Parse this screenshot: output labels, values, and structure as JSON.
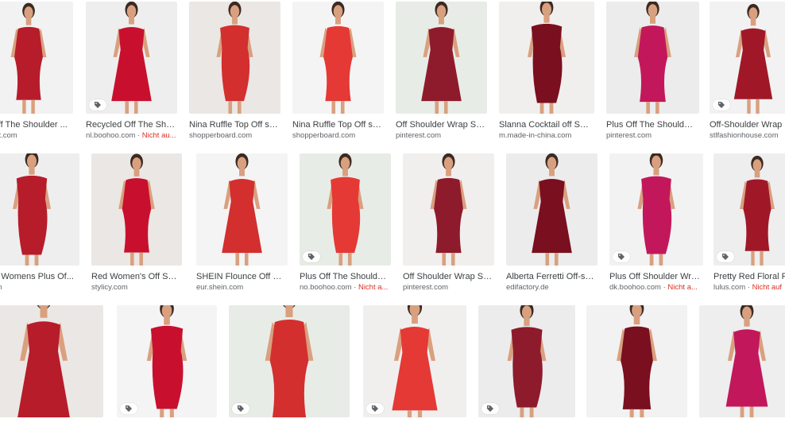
{
  "accent": "#d93025",
  "dress_colors": [
    "#b71c2b",
    "#c8102e",
    "#d32f2f",
    "#e53935",
    "#8e1b2c",
    "#7a0f1f",
    "#c2185b",
    "#a01828"
  ],
  "rows": [
    {
      "items": [
        {
          "title": "e Off The Shoulder ...",
          "source": "erest.com",
          "note": "",
          "tag": false
        },
        {
          "title": "Recycled Off The Shoul...",
          "source": "nl.boohoo.com",
          "note": "Nicht au...",
          "tag": true
        },
        {
          "title": "Nina Ruffle Top Off sho...",
          "source": "shopperboard.com",
          "note": "",
          "tag": false
        },
        {
          "title": "Nina Ruffle Top Off sho...",
          "source": "shopperboard.com",
          "note": "",
          "tag": false
        },
        {
          "title": "Off Shoulder Wrap Skir...",
          "source": "pinterest.com",
          "note": "",
          "tag": false
        },
        {
          "title": "Slanna Cocktail off Sho...",
          "source": "m.made-in-china.com",
          "note": "",
          "tag": false
        },
        {
          "title": "Plus Off The Shoulder ...",
          "source": "pinterest.com",
          "note": "",
          "tag": false
        },
        {
          "title": "Off-Shoulder Wrap Dr",
          "source": "stlfashionhouse.com",
          "note": "",
          "tag": true
        }
      ]
    },
    {
      "items": [
        {
          "title": "hoo Womens Plus Of...",
          "source": "l.com",
          "note": "",
          "tag": false
        },
        {
          "title": "Red Women's Off Shoul...",
          "source": "stylicy.com",
          "note": "",
          "tag": false
        },
        {
          "title": "SHEIN Flounce Off Sho...",
          "source": "eur.shein.com",
          "note": "",
          "tag": false
        },
        {
          "title": "Plus Off The Shoulder ...",
          "source": "no.boohoo.com",
          "note": "Nicht a...",
          "tag": true
        },
        {
          "title": "Off Shoulder Wrap Skir...",
          "source": "pinterest.com",
          "note": "",
          "tag": false
        },
        {
          "title": "Alberta Ferretti Off-sho...",
          "source": "edifactory.de",
          "note": "",
          "tag": false
        },
        {
          "title": "Plus Off Shoulder Wrap...",
          "source": "dk.boohoo.com",
          "note": "Nicht a...",
          "tag": true
        },
        {
          "title": "Pretty Red Floral Pri",
          "source": "lulus.com",
          "note": "Nicht auf",
          "tag": true
        }
      ]
    },
    {
      "items": [
        {
          "title": "",
          "source": "",
          "note": "",
          "tag": false
        },
        {
          "title": "",
          "source": "",
          "note": "",
          "tag": true
        },
        {
          "title": "",
          "source": "",
          "note": "",
          "tag": true
        },
        {
          "title": "",
          "source": "",
          "note": "",
          "tag": true
        },
        {
          "title": "",
          "source": "",
          "note": "",
          "tag": true
        },
        {
          "title": "",
          "source": "",
          "note": "",
          "tag": false
        },
        {
          "title": "",
          "source": "",
          "note": "",
          "tag": false
        }
      ]
    }
  ],
  "tag_icon": "price-tag-icon"
}
